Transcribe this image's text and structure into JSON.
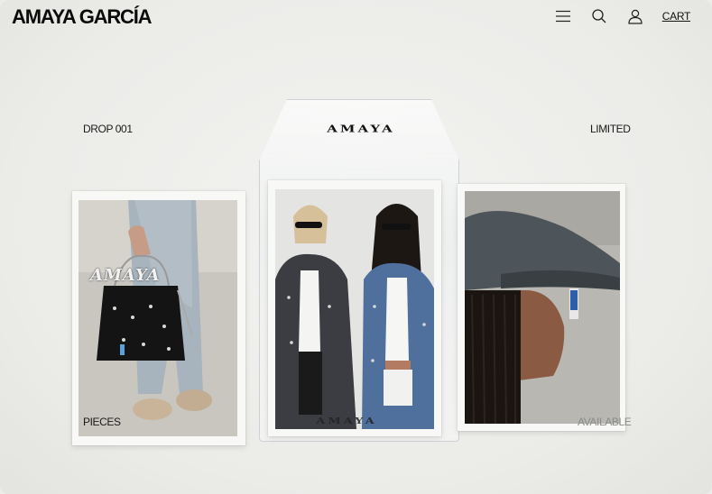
{
  "header": {
    "brand": "AMAYA GARCÍA",
    "cart_label": "CART",
    "icons": [
      "menu-icon",
      "search-icon",
      "user-icon"
    ]
  },
  "labels": {
    "top_left": "DROP 001",
    "top_right": "LIMITED",
    "bottom_left": "PIECES",
    "bottom_right": "AVAILABLE"
  },
  "bag": {
    "logo_text": "AMAYA",
    "bottom_logo_text": "AMAYA"
  },
  "left_card": {
    "overlay_text": "AMAYA"
  },
  "colors": {
    "background": "#ececea",
    "text": "#111111"
  }
}
